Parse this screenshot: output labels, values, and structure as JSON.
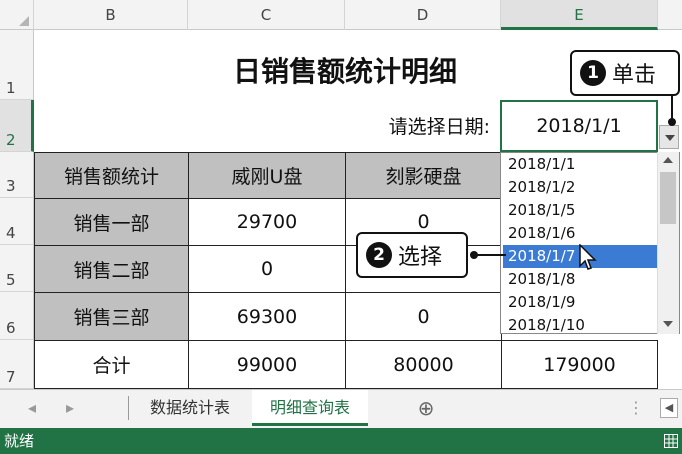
{
  "columns": {
    "corner": "",
    "b": "B",
    "c": "C",
    "d": "D",
    "e": "E"
  },
  "rows": {
    "r1": "1",
    "r2": "2",
    "r3": "3",
    "r4": "4",
    "r5": "5",
    "r6": "6",
    "r7": "7"
  },
  "title": "日销售额统计明细",
  "date_label": "请选择日期:",
  "date_value": "2018/1/1",
  "table": {
    "header": [
      "销售额统计",
      "威刚U盘",
      "刻影硬盘"
    ],
    "rows": [
      {
        "name": "销售一部",
        "c": "29700",
        "d": "0"
      },
      {
        "name": "销售二部",
        "c": "0"
      },
      {
        "name": "销售三部",
        "c": "69300",
        "d": "0"
      }
    ],
    "total": {
      "name": "合计",
      "c": "99000",
      "d": "80000",
      "e": "179000"
    }
  },
  "dropdown": {
    "options": [
      "2018/1/1",
      "2018/1/2",
      "2018/1/5",
      "2018/1/6",
      "2018/1/7",
      "2018/1/8",
      "2018/1/9",
      "2018/1/10"
    ],
    "selected": "2018/1/7"
  },
  "callouts": {
    "click": {
      "num": "1",
      "text": "单击"
    },
    "select": {
      "num": "2",
      "text": "选择"
    }
  },
  "sheets": {
    "tab1": "数据统计表",
    "tab2": "明细查询表",
    "add": "⊕"
  },
  "status": "就绪",
  "colors": {
    "accent": "#217346",
    "selection": "#3b7bd4",
    "header_gray": "#c0c0c0"
  }
}
